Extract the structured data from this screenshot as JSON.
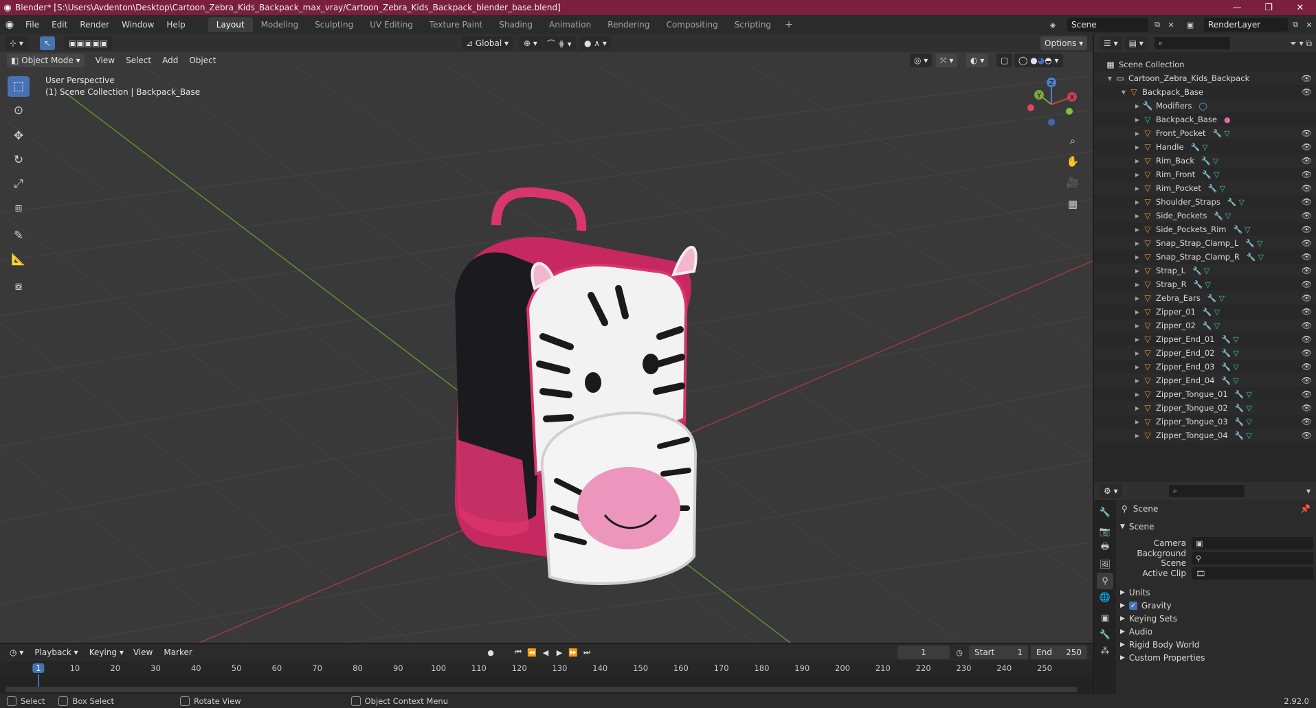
{
  "window": {
    "title": "Blender* [S:\\Users\\Avdenton\\Desktop\\Cartoon_Zebra_Kids_Backpack_max_vray/Cartoon_Zebra_Kids_Backpack_blender_base.blend]"
  },
  "menu": [
    "File",
    "Edit",
    "Render",
    "Window",
    "Help"
  ],
  "workspaces": [
    "Layout",
    "Modeling",
    "Sculpting",
    "UV Editing",
    "Texture Paint",
    "Shading",
    "Animation",
    "Rendering",
    "Compositing",
    "Scripting"
  ],
  "active_workspace": "Layout",
  "scene_field": "Scene",
  "render_layer_field": "RenderLayer",
  "viewport": {
    "transform_orientation": "Global",
    "options_label": "Options",
    "mode": "Object Mode",
    "menus": [
      "View",
      "Select",
      "Add",
      "Object"
    ],
    "overlay_line1": "User Perspective",
    "overlay_line2": "(1) Scene Collection | Backpack_Base",
    "gizmo_axes": [
      "X",
      "Y",
      "Z"
    ]
  },
  "outliner": {
    "root": "Scene Collection",
    "collection": "Cartoon_Zebra_Kids_Backpack",
    "object": "Backpack_Base",
    "modifiers_label": "Modifiers",
    "mesh_data": "Backpack_Base",
    "children": [
      "Front_Pocket",
      "Handle",
      "Rim_Back",
      "Rim_Front",
      "Rim_Pocket",
      "Shoulder_Straps",
      "Side_Pockets",
      "Side_Pockets_Rim",
      "Snap_Strap_Clamp_L",
      "Snap_Strap_Clamp_R",
      "Strap_L",
      "Strap_R",
      "Zebra_Ears",
      "Zipper_01",
      "Zipper_02",
      "Zipper_End_01",
      "Zipper_End_02",
      "Zipper_End_03",
      "Zipper_End_04",
      "Zipper_Tongue_01",
      "Zipper_Tongue_02",
      "Zipper_Tongue_03",
      "Zipper_Tongue_04"
    ]
  },
  "properties": {
    "context": "Scene",
    "panel": "Scene",
    "fields": [
      {
        "label": "Camera",
        "value": ""
      },
      {
        "label": "Background Scene",
        "value": ""
      },
      {
        "label": "Active Clip",
        "value": ""
      }
    ],
    "sections": [
      "Units",
      "Gravity",
      "Keying Sets",
      "Audio",
      "Rigid Body World",
      "Custom Properties"
    ],
    "gravity_checked": true
  },
  "timeline": {
    "menus": [
      "Playback",
      "Keying",
      "View",
      "Marker"
    ],
    "current_frame": "1",
    "start_label": "Start",
    "start": "1",
    "end_label": "End",
    "end": "250",
    "ticks": [
      "1",
      "10",
      "20",
      "30",
      "40",
      "50",
      "60",
      "70",
      "80",
      "90",
      "100",
      "110",
      "120",
      "130",
      "140",
      "150",
      "160",
      "170",
      "180",
      "190",
      "200",
      "210",
      "220",
      "230",
      "240",
      "250"
    ]
  },
  "statusbar": {
    "items": [
      "Select",
      "Box Select",
      "Rotate View",
      "Object Context Menu"
    ],
    "version": "2.92.0"
  },
  "colors": {
    "titlebar": "#7a1f3d",
    "accent_blue": "#4772b3",
    "mesh_orange": "#e8963c",
    "axis_red": "#c84050",
    "axis_green": "#7ca63a"
  }
}
